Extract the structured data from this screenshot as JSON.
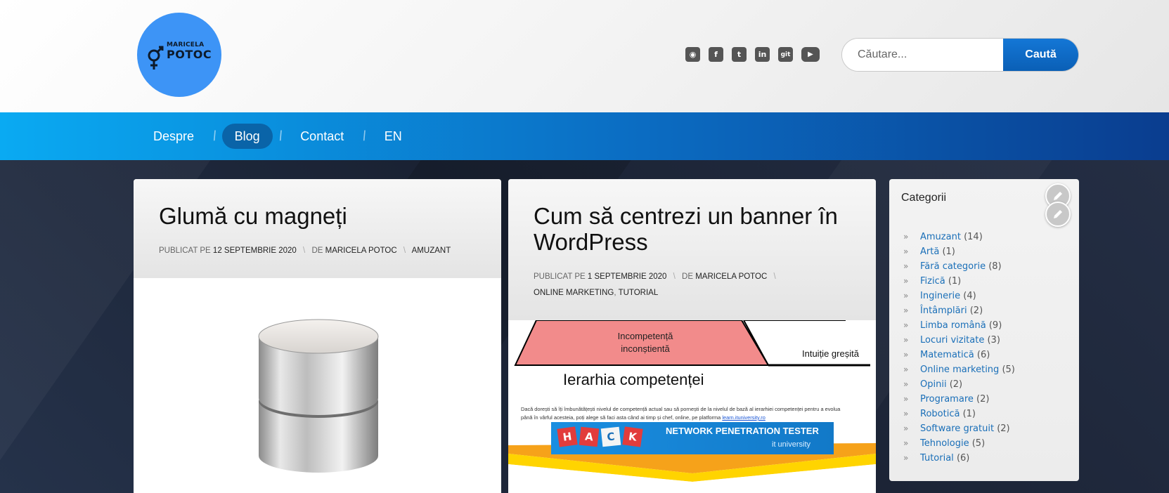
{
  "header": {
    "logo": {
      "line1": "MARICELA",
      "line2": "POTOC"
    },
    "social_icons": [
      {
        "name": "rss-icon",
        "glyph": "◉"
      },
      {
        "name": "facebook-icon",
        "glyph": "f"
      },
      {
        "name": "twitter-icon",
        "glyph": "t"
      },
      {
        "name": "linkedin-icon",
        "glyph": "in"
      },
      {
        "name": "git-icon",
        "glyph": "git"
      },
      {
        "name": "youtube-icon",
        "glyph": "▶"
      }
    ],
    "search": {
      "placeholder": "Căutare...",
      "button_label": "Caută"
    }
  },
  "nav": {
    "items": [
      {
        "label": "Despre",
        "active": false
      },
      {
        "label": "Blog",
        "active": true
      },
      {
        "label": "Contact",
        "active": false
      },
      {
        "label": "EN",
        "active": false
      }
    ]
  },
  "posts": [
    {
      "title": "Glumă cu magneți",
      "meta": {
        "published_prefix": "PUBLICAT PE",
        "date": "12 SEPTEMBRIE 2020",
        "by_prefix": "DE",
        "author": "MARICELA POTOC",
        "categories": [
          "AMUZANT"
        ]
      }
    },
    {
      "title": "Cum să centrezi un banner în WordPress",
      "meta": {
        "published_prefix": "PUBLICAT PE",
        "date": "1 SEPTEMBRIE 2020",
        "by_prefix": "DE",
        "author": "MARICELA POTOC",
        "categories": [
          "ONLINE MARKETING",
          "TUTORIAL"
        ]
      },
      "image": {
        "top_box": "Incompetență inconștientă",
        "right_label": "Intuiție greșită",
        "heading": "Ierarhia competenței",
        "paragraph_line1": "Dacă dorești să îți îmbunătățești nivelul de competență actual sau să pornești de la nivelul de bază al ierarhiei competenței pentru a evolua",
        "paragraph_line2": "până în vârful acesteia, poți alege să faci asta când ai timp și chef, online, pe platforma",
        "link": "learn.ituniversity.ro",
        "banner_letters": [
          "H",
          "A",
          "C",
          "K"
        ],
        "banner_text": "NETWORK PENETRATION TESTER",
        "banner_sub": "it university"
      }
    }
  ],
  "sidebar": {
    "title": "Categorii",
    "categories": [
      {
        "name": "Amuzant",
        "count": "(14)"
      },
      {
        "name": "Artă",
        "count": "(1)"
      },
      {
        "name": "Fără categorie",
        "count": "(8)"
      },
      {
        "name": "Fizică",
        "count": "(1)"
      },
      {
        "name": "Inginerie",
        "count": "(4)"
      },
      {
        "name": "Întâmplări",
        "count": "(2)"
      },
      {
        "name": "Limba română",
        "count": "(9)"
      },
      {
        "name": "Locuri vizitate",
        "count": "(3)"
      },
      {
        "name": "Matematică",
        "count": "(6)"
      },
      {
        "name": "Online marketing",
        "count": "(5)"
      },
      {
        "name": "Opinii",
        "count": "(2)"
      },
      {
        "name": "Programare",
        "count": "(2)"
      },
      {
        "name": "Robotică",
        "count": "(1)"
      },
      {
        "name": "Software gratuit",
        "count": "(2)"
      },
      {
        "name": "Tehnologie",
        "count": "(5)"
      },
      {
        "name": "Tutorial",
        "count": "(6)"
      }
    ]
  }
}
